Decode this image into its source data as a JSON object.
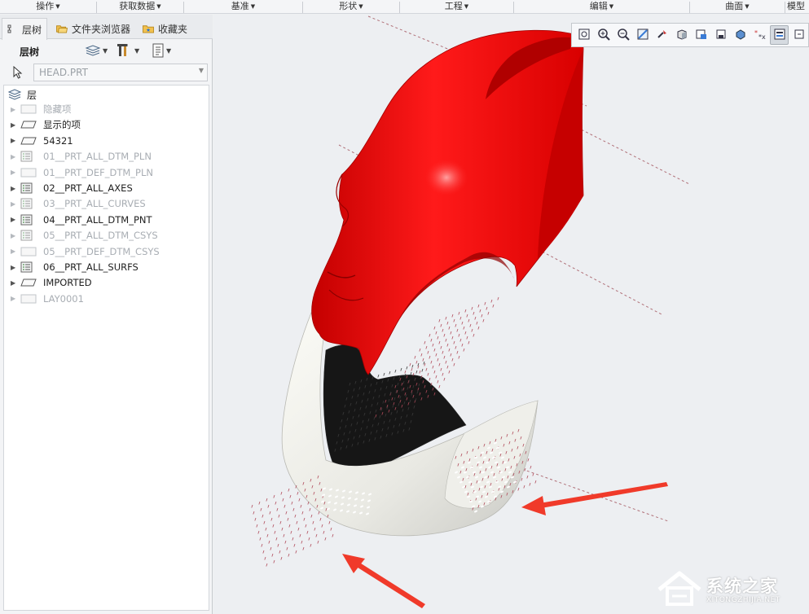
{
  "ribbon": {
    "groups": [
      {
        "label": "操作"
      },
      {
        "label": "获取数据"
      },
      {
        "label": "基准"
      },
      {
        "label": "形状"
      },
      {
        "label": "工程"
      },
      {
        "label": "编辑"
      },
      {
        "label": "曲面"
      },
      {
        "label": "模型"
      }
    ]
  },
  "panel": {
    "tabs": [
      {
        "label": "层树",
        "icon": "layer-tree-icon"
      },
      {
        "label": "文件夹浏览器",
        "icon": "folder-browser-icon"
      },
      {
        "label": "收藏夹",
        "icon": "favorites-icon"
      }
    ],
    "subbar_title": "层树",
    "selector_value": "HEAD.PRT",
    "tree_root": "层",
    "layers": [
      {
        "label": "隐藏项",
        "icon": "layer-rect-icon",
        "state": "dim"
      },
      {
        "label": "显示的项",
        "icon": "layer-plane-icon",
        "state": "norm"
      },
      {
        "label": "54321",
        "icon": "layer-plane-icon",
        "state": "norm"
      },
      {
        "label": "01__PRT_ALL_DTM_PLN",
        "icon": "layer-list-icon",
        "state": "dim"
      },
      {
        "label": "01__PRT_DEF_DTM_PLN",
        "icon": "layer-rect-icon",
        "state": "dim"
      },
      {
        "label": "02__PRT_ALL_AXES",
        "icon": "layer-list-icon",
        "state": "norm"
      },
      {
        "label": "03__PRT_ALL_CURVES",
        "icon": "layer-list-icon",
        "state": "dim"
      },
      {
        "label": "04__PRT_ALL_DTM_PNT",
        "icon": "layer-list-icon",
        "state": "norm"
      },
      {
        "label": "05__PRT_ALL_DTM_CSYS",
        "icon": "layer-list-icon",
        "state": "dim"
      },
      {
        "label": "05__PRT_DEF_DTM_CSYS",
        "icon": "layer-rect-icon",
        "state": "dim"
      },
      {
        "label": "06__PRT_ALL_SURFS",
        "icon": "layer-list-icon",
        "state": "norm"
      },
      {
        "label": "IMPORTED",
        "icon": "layer-plane-icon",
        "state": "norm"
      },
      {
        "label": "LAY0001",
        "icon": "layer-rect-icon",
        "state": "dim"
      }
    ]
  },
  "viewbar": {
    "buttons": [
      "zoom-fit-icon",
      "zoom-in-icon",
      "zoom-out-icon",
      "repaint-icon",
      "spin-center-icon",
      "shading-icon",
      "saved-views-icon",
      "perspective-icon",
      "display-style-icon",
      "datum-display-icon",
      "annotation-display-icon",
      "more-icon"
    ]
  },
  "watermark": {
    "text": "系统之家",
    "url": "XITONGZHIJIA.NET"
  },
  "colors": {
    "accent": "#e00000",
    "highlight_arrow": "#f03a2a",
    "panel_bg": "#f3f4f6"
  }
}
